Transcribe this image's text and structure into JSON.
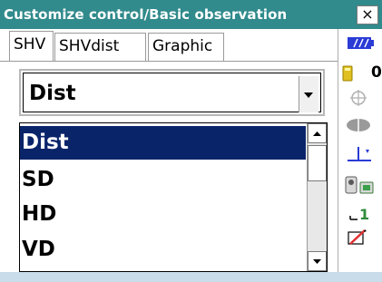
{
  "window": {
    "title": "Customize control/Basic observation",
    "close_label": "×"
  },
  "tabs": [
    {
      "label": "SHV",
      "active": true
    },
    {
      "label": "SHVdist",
      "active": false
    },
    {
      "label": "Graphic",
      "active": false
    }
  ],
  "combo": {
    "selected_value": "Dist"
  },
  "dropdown": {
    "items": [
      {
        "label": "Dist",
        "selected": true
      },
      {
        "label": "SD",
        "selected": false
      },
      {
        "label": "HD",
        "selected": false
      },
      {
        "label": "VD",
        "selected": false
      }
    ]
  },
  "status_bar": {
    "memory_count": "0",
    "icons": [
      "battery-icon",
      "sd-card-icon",
      "crosshair-target-icon",
      "laser-ellipse-icon",
      "ground-target-icon",
      "bluetooth-device-icon",
      "face-1-indicator-icon",
      "edit-pencil-icon"
    ],
    "face_indicator": "1"
  },
  "colors": {
    "titlebar": "#318a8c",
    "selection": "#0a246a",
    "bottombar": "#c9dcea"
  }
}
